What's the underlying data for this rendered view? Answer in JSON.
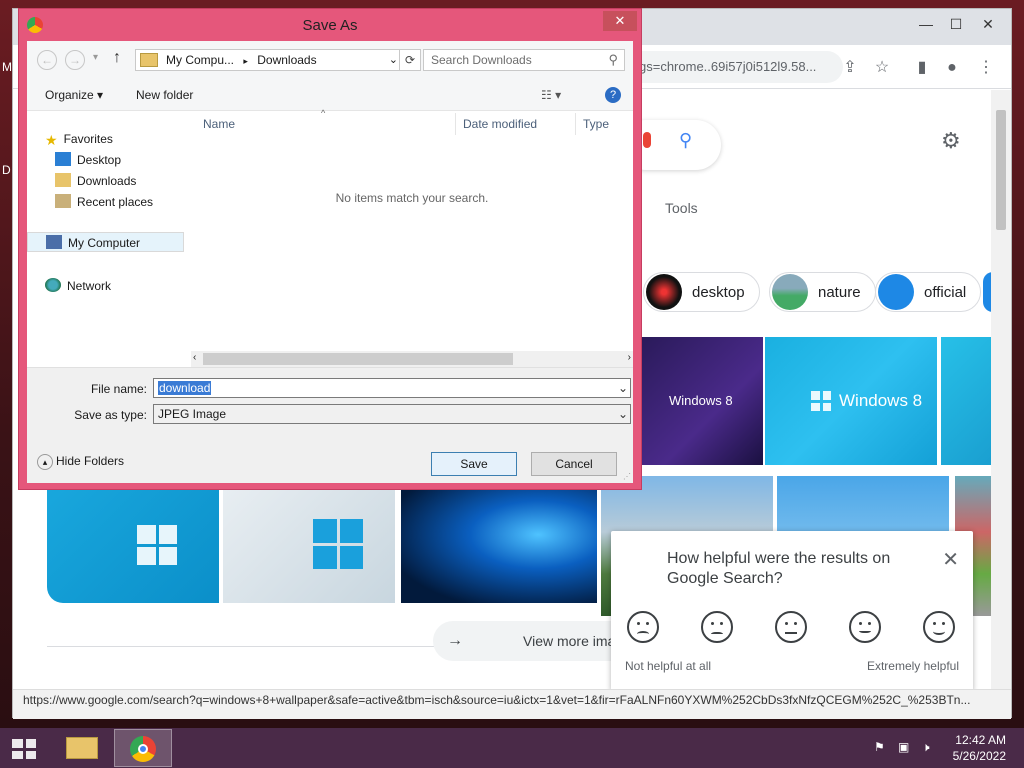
{
  "desktop": {
    "letters": [
      "M",
      "D"
    ]
  },
  "chrome": {
    "address_text": "gs=chrome..69i57j0i512l9.58...",
    "window_controls": {
      "minimize": "—",
      "maximize": "☐",
      "close": "✕"
    },
    "tab_chevron": "⌄",
    "status_url": "https://www.google.com/search?q=windows+8+wallpaper&safe=active&tbm=isch&source=iu&ictx=1&vet=1&fir=rFaALNFn60YXWM%252CbDs3fxNfzQCEGM%252C_%253BTn...",
    "tools_label": "Tools",
    "chips": [
      "desktop",
      "nature",
      "official"
    ],
    "tiles": {
      "windows8_a": "Windows 8",
      "windows8_b": "Windows 8"
    },
    "view_more": "View more ima",
    "feedback": {
      "question": "How helpful were the results on Google Search?",
      "low_label": "Not helpful at all",
      "high_label": "Extremely helpful"
    }
  },
  "dialog": {
    "title": "Save As",
    "close": "✕",
    "breadcrumb": {
      "root": "My Compu...",
      "sep": "▸",
      "current": "Downloads"
    },
    "search_placeholder": "Search Downloads",
    "organize": "Organize ▾",
    "new_folder": "New folder",
    "nav": {
      "favorites": "Favorites",
      "desktop": "Desktop",
      "downloads": "Downloads",
      "recent": "Recent places",
      "my_computer": "My Computer",
      "network": "Network"
    },
    "columns": {
      "name": "Name",
      "date_modified": "Date modified",
      "type": "Type"
    },
    "empty_message": "No items match your search.",
    "file_name_label": "File name:",
    "file_name_value": "download",
    "save_as_type_label": "Save as type:",
    "save_as_type_value": "JPEG Image",
    "hide_folders": "Hide Folders",
    "save": "Save",
    "cancel": "Cancel"
  },
  "taskbar": {
    "time": "12:42 AM",
    "date": "5/26/2022"
  }
}
